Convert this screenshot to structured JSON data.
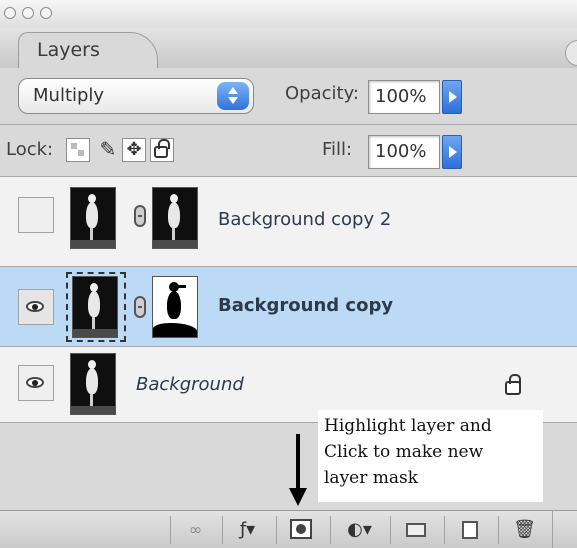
{
  "panel": {
    "tab_label": "Layers"
  },
  "blend": {
    "mode": "Multiply",
    "opacity_label": "Opacity:",
    "opacity_value": "100%"
  },
  "lock": {
    "label": "Lock:",
    "fill_label": "Fill:",
    "fill_value": "100%"
  },
  "layers": [
    {
      "name": "Background copy 2",
      "visible": false,
      "selected": false
    },
    {
      "name": "Background copy",
      "visible": true,
      "selected": true
    },
    {
      "name": "Background",
      "visible": true,
      "selected": false,
      "locked": true
    }
  ],
  "annotation": {
    "line1": "Highlight layer and",
    "line2": "Click to make new",
    "line3": "layer mask"
  },
  "colors": {
    "selected_row": "#bcd9f6",
    "panel_bg": "#d9d9d9",
    "accent": "#2f73d8"
  },
  "icons": {
    "window_buttons": [
      "close-icon",
      "minimize-icon",
      "zoom-icon"
    ],
    "lock_buttons": [
      "lock-transparency-icon",
      "lock-paint-icon",
      "lock-move-icon",
      "lock-all-icon"
    ],
    "bottom_buttons": [
      "link-layers-icon",
      "layer-style-icon",
      "add-layer-mask-icon",
      "adjustment-layer-icon",
      "new-group-icon",
      "new-layer-icon",
      "delete-layer-icon"
    ]
  }
}
